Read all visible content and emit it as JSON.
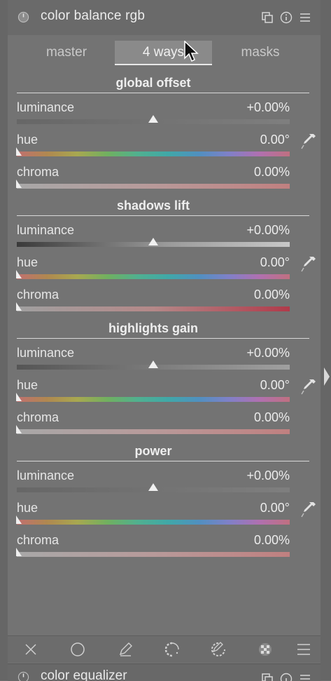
{
  "module": {
    "title": "color balance rgb",
    "icons": [
      "power-icon",
      "presets-icon",
      "info-icon",
      "menu-icon"
    ]
  },
  "tabs": [
    {
      "label": "master",
      "active": false
    },
    {
      "label": "4 ways",
      "active": true
    },
    {
      "label": "masks",
      "active": false
    }
  ],
  "sections": [
    {
      "title": "global offset",
      "luminance": {
        "label": "luminance",
        "value": "+0.00%"
      },
      "hue": {
        "label": "hue",
        "value": "0.00°"
      },
      "chroma": {
        "label": "chroma",
        "value": "0.00%"
      }
    },
    {
      "title": "shadows lift",
      "luminance": {
        "label": "luminance",
        "value": "+0.00%"
      },
      "hue": {
        "label": "hue",
        "value": "0.00°"
      },
      "chroma": {
        "label": "chroma",
        "value": "0.00%"
      }
    },
    {
      "title": "highlights gain",
      "luminance": {
        "label": "luminance",
        "value": "+0.00%"
      },
      "hue": {
        "label": "hue",
        "value": "0.00°"
      },
      "chroma": {
        "label": "chroma",
        "value": "0.00%"
      }
    },
    {
      "title": "power",
      "luminance": {
        "label": "luminance",
        "value": "+0.00%"
      },
      "hue": {
        "label": "hue",
        "value": "0.00°"
      },
      "chroma": {
        "label": "chroma",
        "value": "0.00%"
      }
    }
  ],
  "footer": {
    "icons": [
      "close-icon",
      "circle-icon",
      "pencil-icon",
      "parametric-mask-icon",
      "drawn-parametric-mask-icon",
      "raster-mask-icon",
      "blend-menu-icon"
    ]
  },
  "next_module": {
    "title": "color equalizer"
  }
}
